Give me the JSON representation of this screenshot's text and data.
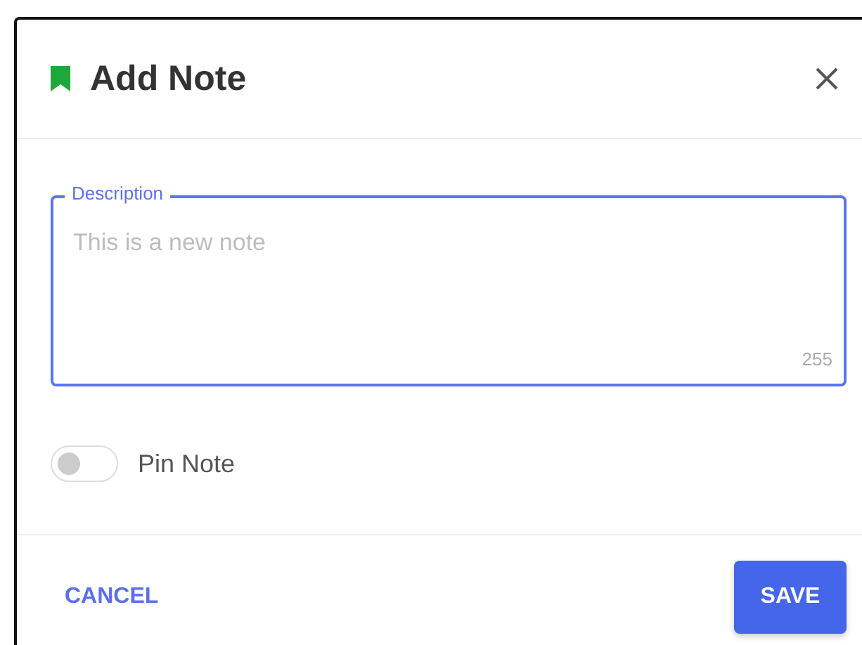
{
  "dialog": {
    "title": "Add Note",
    "field": {
      "label": "Description",
      "placeholder": "This is a new note",
      "counter": "255"
    },
    "toggle": {
      "label": "Pin Note",
      "on": false
    },
    "buttons": [
      {
        "label": "CANCEL",
        "kind": "text"
      },
      {
        "label": "SAVE",
        "kind": "filled"
      }
    ]
  }
}
